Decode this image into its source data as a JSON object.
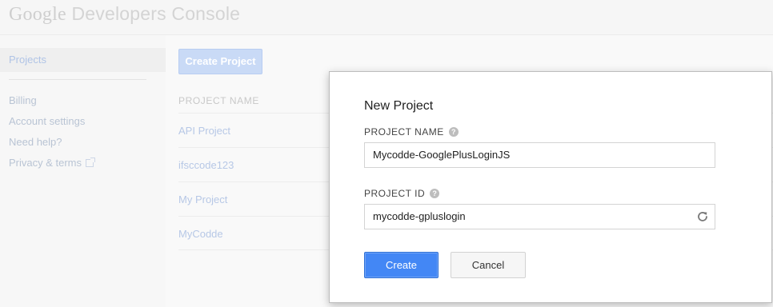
{
  "header": {
    "logo_google": "Google",
    "logo_product": "Developers Console"
  },
  "sidebar": {
    "items": [
      {
        "label": "Projects",
        "active": true
      },
      {
        "label": "Billing"
      },
      {
        "label": "Account settings"
      },
      {
        "label": "Need help?"
      },
      {
        "label": "Privacy & terms",
        "icon": "external-link-icon"
      }
    ]
  },
  "main": {
    "create_project_label": "Create Project",
    "column_header": "PROJECT NAME",
    "projects": [
      "API Project",
      "ifsccode123",
      "My Project",
      "MyCodde"
    ]
  },
  "dialog": {
    "title": "New Project",
    "project_name_label": "PROJECT NAME",
    "project_name_value": "Mycodde-GooglePlusLoginJS",
    "project_id_label": "PROJECT ID",
    "project_id_value": "mycodde-gpluslogin",
    "help_icon": "?",
    "create_label": "Create",
    "cancel_label": "Cancel"
  },
  "colors": {
    "primary_button": "#4387f5",
    "disabled_button": "#c9daf6",
    "dim_link": "#b7c8e6"
  }
}
